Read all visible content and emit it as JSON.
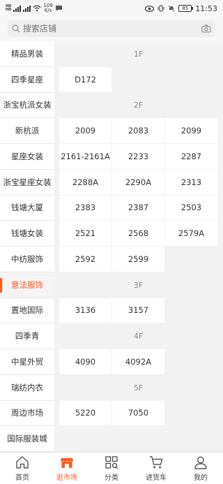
{
  "status_bar": {
    "network_speed": "109",
    "network_unit": "K/s",
    "battery": "85",
    "time": "11:53"
  },
  "search": {
    "placeholder": "搜索店铺"
  },
  "sidebar": {
    "items": [
      {
        "label": "精品男装"
      },
      {
        "label": "四季星座"
      },
      {
        "label": "浙宝杭派女装"
      },
      {
        "label": "新杭派"
      },
      {
        "label": "星座女装"
      },
      {
        "label": "浙宝星座女装"
      },
      {
        "label": "钱塘大厦"
      },
      {
        "label": "钱塘女装"
      },
      {
        "label": "中纺服饰"
      },
      {
        "label": "意法服饰",
        "active": true
      },
      {
        "label": "置地国际"
      },
      {
        "label": "四季青"
      },
      {
        "label": "中星外贸"
      },
      {
        "label": "瑞纺内衣"
      },
      {
        "label": "周边市场"
      },
      {
        "label": "国际服装城"
      }
    ]
  },
  "content": {
    "rows": [
      {
        "floor": "1F"
      },
      {
        "cells": [
          "D172"
        ]
      },
      {
        "floor": "2F"
      },
      {
        "cells": [
          "2009",
          "2083",
          "2099"
        ]
      },
      {
        "cells": [
          "2161-2161A",
          "2233",
          "2287"
        ]
      },
      {
        "cells": [
          "2288A",
          "2290A",
          "2313"
        ]
      },
      {
        "cells": [
          "2383",
          "2387",
          "2503"
        ]
      },
      {
        "cells": [
          "2521",
          "2568",
          "2579A"
        ]
      },
      {
        "cells": [
          "2592",
          "2599"
        ]
      },
      {
        "floor": "3F"
      },
      {
        "cells": [
          "3136",
          "3157"
        ]
      },
      {
        "floor": "4F"
      },
      {
        "cells": [
          "4090",
          "4092A"
        ]
      },
      {
        "floor": "5F"
      },
      {
        "cells": [
          "5220",
          "7050"
        ]
      }
    ]
  },
  "tabbar": {
    "tabs": [
      {
        "label": "首页",
        "icon": "home-icon"
      },
      {
        "label": "逛市场",
        "icon": "shop-icon",
        "active": true
      },
      {
        "label": "分类",
        "icon": "category-icon"
      },
      {
        "label": "进货车",
        "icon": "cart-icon"
      },
      {
        "label": "我的",
        "icon": "user-icon"
      }
    ]
  },
  "colors": {
    "accent": "#ff5a1f",
    "background": "#f2f2f2"
  }
}
